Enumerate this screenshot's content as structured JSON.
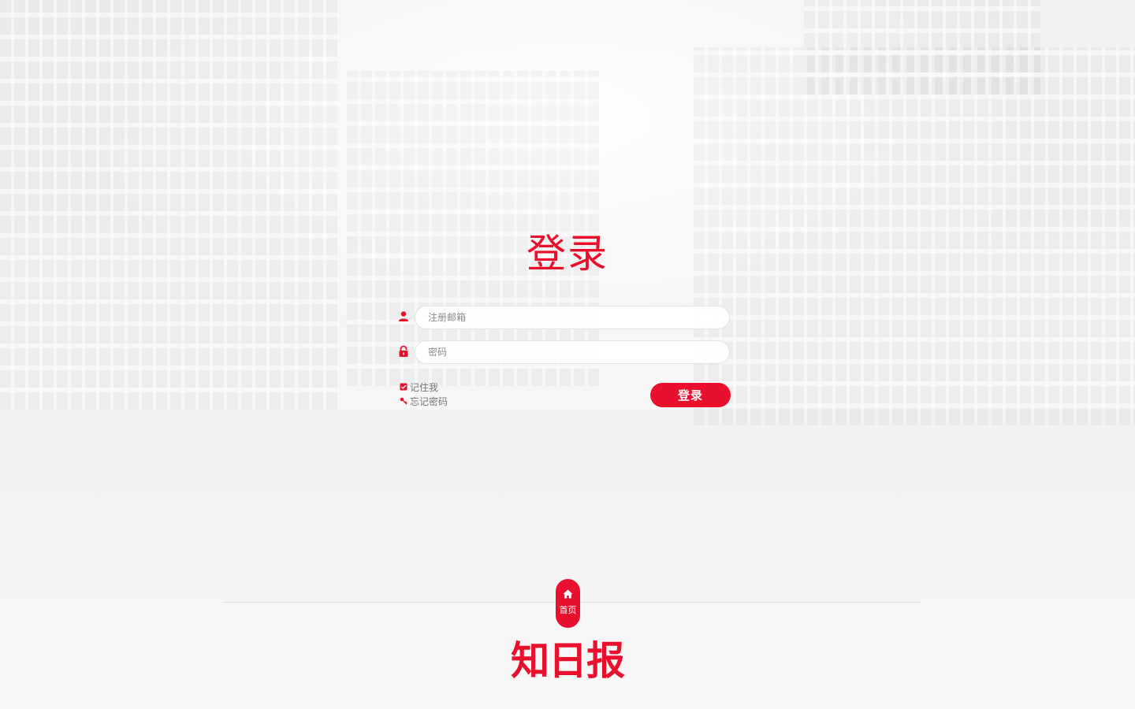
{
  "login": {
    "title": "登录",
    "email": {
      "placeholder": "注册邮箱",
      "value": ""
    },
    "password": {
      "placeholder": "密码",
      "value": ""
    },
    "remember_label": "记住我",
    "forgot_label": "忘记密码",
    "submit_label": "登录"
  },
  "footer": {
    "home_label": "首页",
    "brand": "知日报"
  },
  "colors": {
    "accent": "#e8102c"
  },
  "icons": {
    "email": "user-icon",
    "password": "lock-icon",
    "remember": "checkbox-checked-icon",
    "forgot": "key-icon",
    "home": "home-icon"
  }
}
